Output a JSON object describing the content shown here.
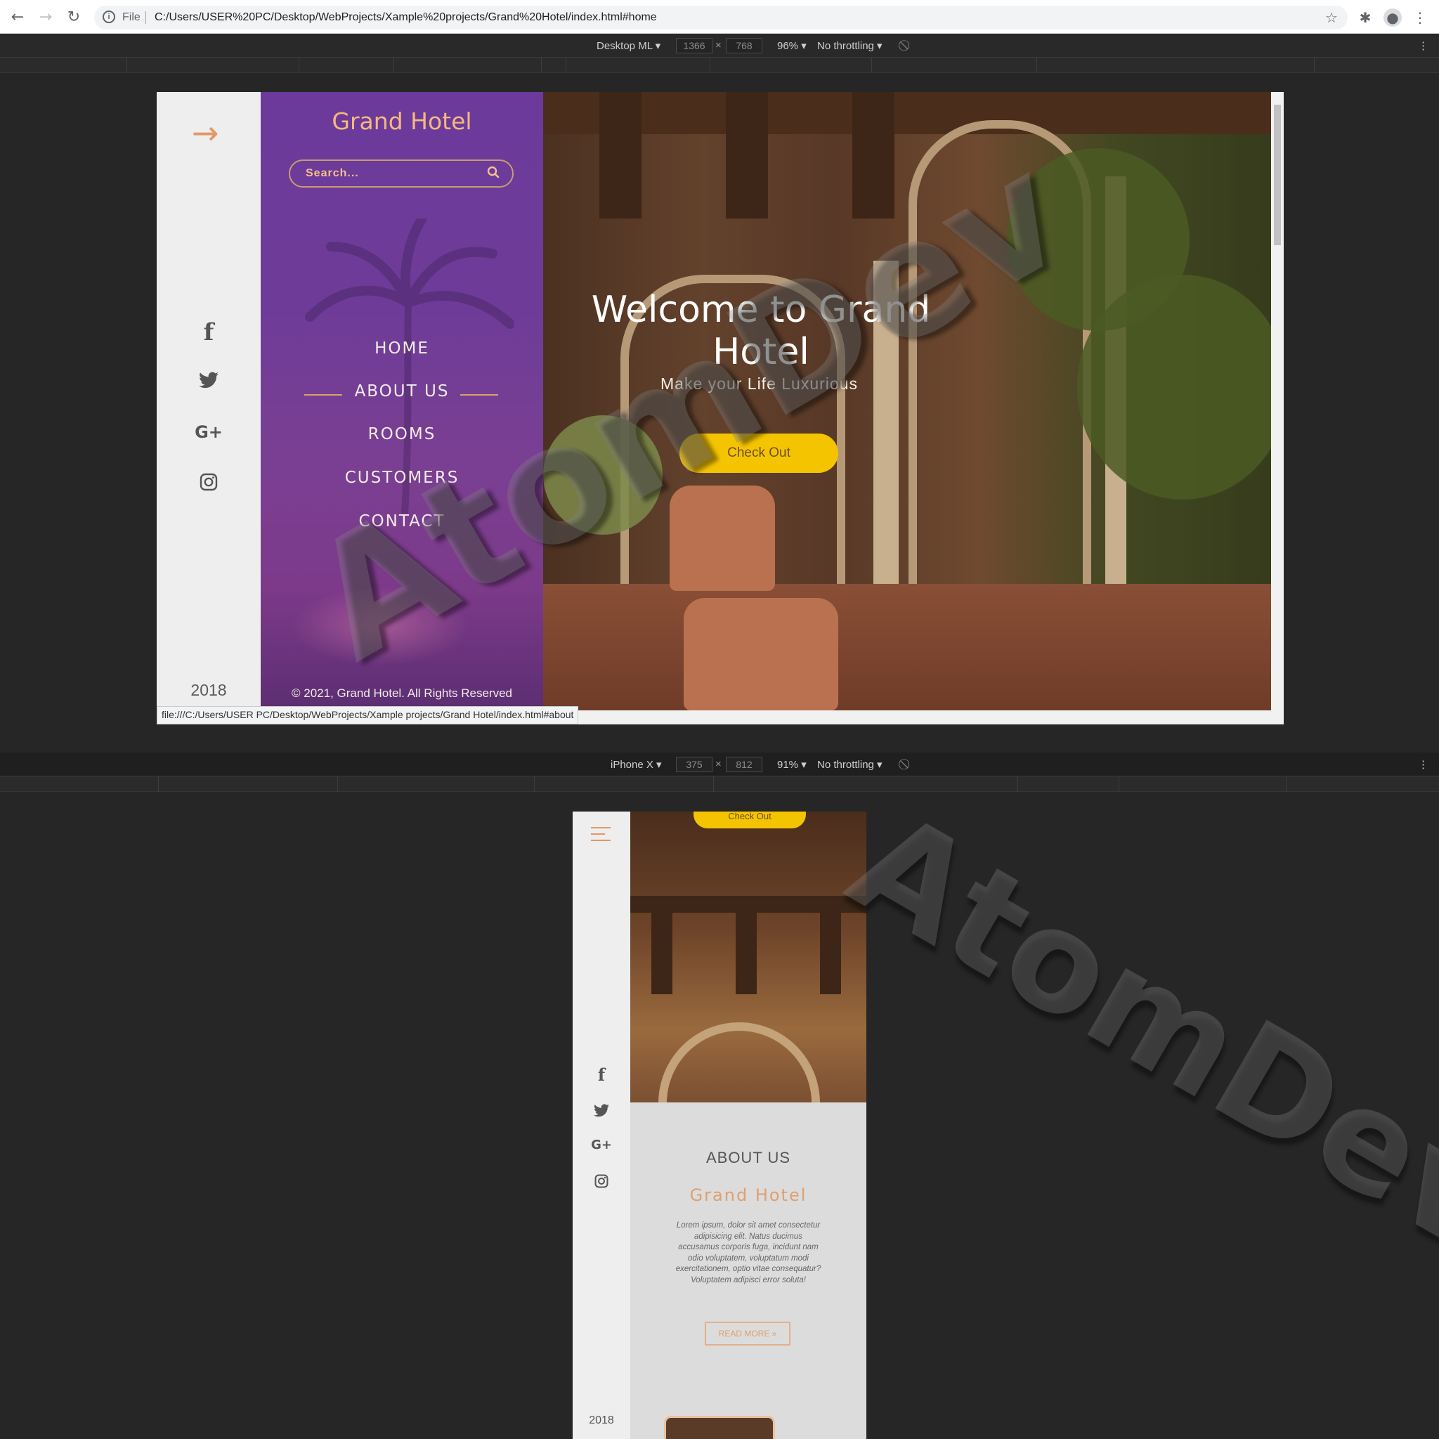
{
  "browser": {
    "file_label": "File",
    "url": "C:/Users/USER%20PC/Desktop/WebProjects/Xample%20projects/Grand%20Hotel/index.html#home",
    "status_url": "file:///C:/Users/USER PC/Desktop/WebProjects/Xample projects/Grand Hotel/index.html#about"
  },
  "devtools_desktop": {
    "device": "Desktop ML ▾",
    "width": "1366",
    "height": "768",
    "times": "×",
    "zoom": "96% ▾",
    "throttle": "No throttling ▾"
  },
  "devtools_mobile": {
    "device": "iPhone X ▾",
    "width": "375",
    "height": "812",
    "times": "×",
    "zoom": "91% ▾",
    "throttle": "No throttling ▾"
  },
  "site": {
    "brand": "Grand Hotel",
    "search_placeholder": "Search...",
    "menu": [
      {
        "label": "HOME"
      },
      {
        "label": "ABOUT US"
      },
      {
        "label": "ROOMS"
      },
      {
        "label": "CUSTOMERS"
      },
      {
        "label": "CONTACT"
      }
    ],
    "social_icons": [
      "facebook-icon",
      "twitter-icon",
      "google-plus-icon",
      "instagram-icon"
    ],
    "year": "2018",
    "copyright": "© 2021, Grand Hotel. All Rights Reserved",
    "hero_title": "Welcome to Grand Hotel",
    "hero_subtitle": "Make your Life Luxurious",
    "cta": "Check Out"
  },
  "mobile": {
    "cta": "Check Out",
    "about_title": "ABOUT US",
    "about_brand": "Grand Hotel",
    "about_text": "Lorem ipsum, dolor sit amet consectetur adipisicing elit. Natus ducimus accusamus corporis fuga, incidunt nam odio voluptatem, voluptatum modi exercitationem, optio vitae consequatur? Voluptatem adipisci error soluta!",
    "read_more": "READ MORE »",
    "year": "2018"
  },
  "watermark": {
    "text": "AtomDev"
  },
  "colors": {
    "accent": "#e39765",
    "sidebar_purple": "#6e3c98",
    "cta_yellow": "#f5c400",
    "devtools_bg": "#262626"
  }
}
